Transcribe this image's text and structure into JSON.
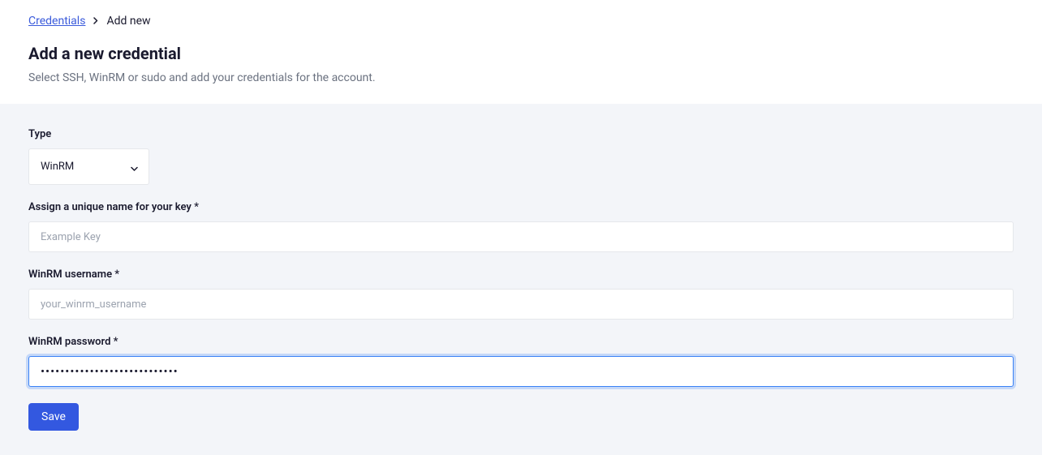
{
  "breadcrumb": {
    "parent_label": "Credentials",
    "current_label": "Add new"
  },
  "header": {
    "title": "Add a new credential",
    "subtitle": "Select SSH, WinRM or sudo and add your credentials for the account."
  },
  "form": {
    "type": {
      "label": "Type",
      "selected": "WinRM"
    },
    "name": {
      "label": "Assign a unique name for your key *",
      "placeholder": "Example Key",
      "value": ""
    },
    "username": {
      "label": "WinRM username *",
      "placeholder": "your_winrm_username",
      "value": ""
    },
    "password": {
      "label": "WinRM password *",
      "value": "abcdefghijklmnopqrstuvwxyzab"
    },
    "save_label": "Save"
  }
}
